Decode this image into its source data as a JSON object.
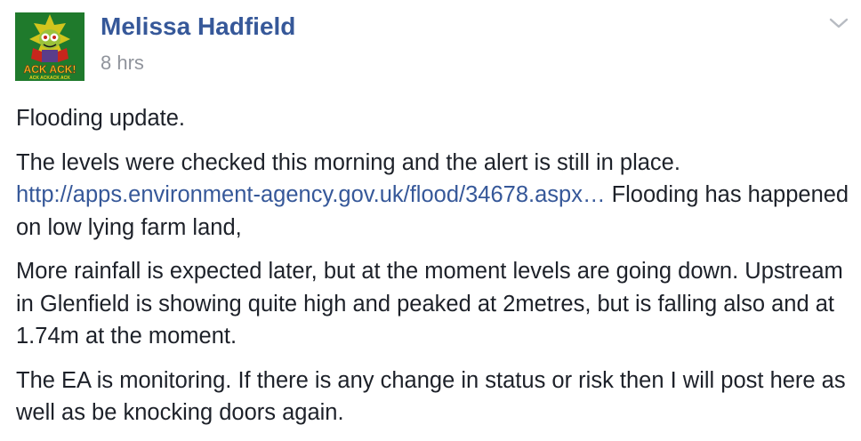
{
  "post": {
    "author_name": "Melissa Hadfield",
    "timestamp": "8 hrs",
    "avatar": {
      "icon": "ack-ack-avatar-icon",
      "caption": "ACK ACK!",
      "subcaption": "ACK ACKACK ACK"
    },
    "menu_icon": "chevron-down-icon",
    "paragraphs": [
      {
        "text": "Flooding update."
      },
      {
        "text_before": "The levels were checked this morning and the alert is still in place.",
        "link_text": "http://apps.environment-agency.gov.uk/flood/34678.aspx…",
        "text_after": "Flooding has happened on low lying farm land,"
      },
      {
        "text": "More rainfall is expected later, but at the moment levels are going down. Upstream in Glenfield is showing quite high and peaked at 2metres, but is falling also and at 1.74m at the moment."
      },
      {
        "text": "The EA is monitoring. If there is any change in status or risk then I will post here as well as be knocking doors again."
      }
    ]
  },
  "colors": {
    "author": "#365899",
    "link": "#365899",
    "timestamp": "#90949c",
    "text": "#1d2129",
    "avatar_bg": "#1f7a2c",
    "avatar_accent": "#f2d21b",
    "avatar_red": "#c8261c"
  }
}
